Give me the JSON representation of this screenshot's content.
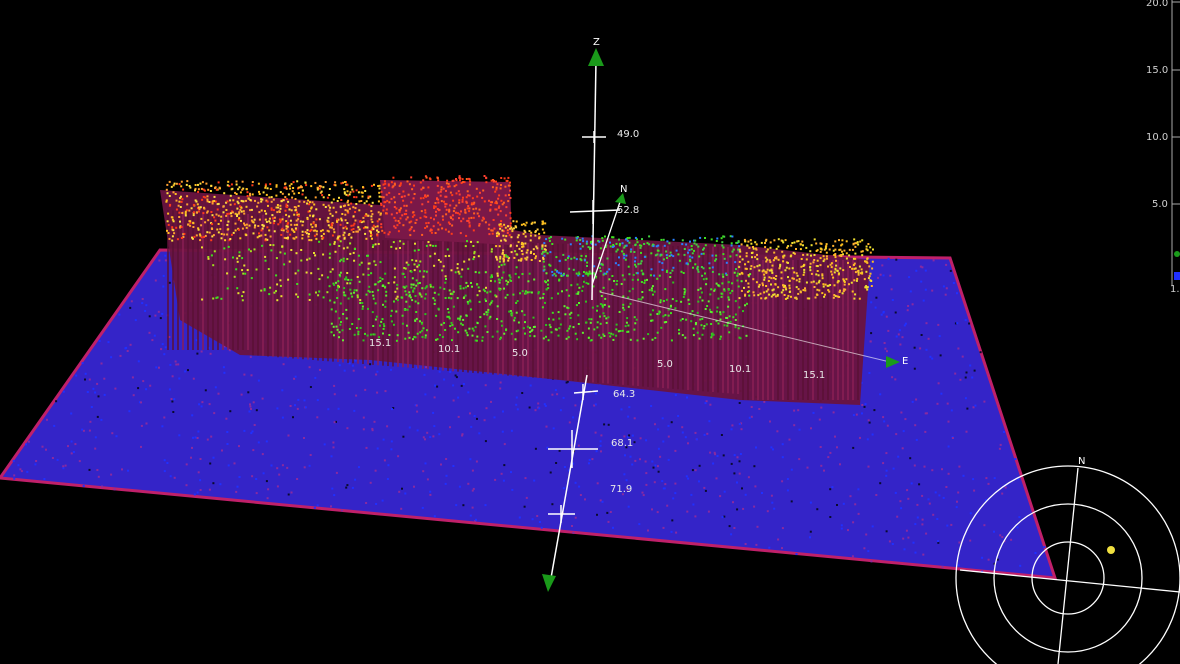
{
  "view": {
    "background": "#000000",
    "seabed_color": "#3a2ad8",
    "seabed_edge_color": "#c0206a",
    "hull_color": "#7a1848"
  },
  "axes": {
    "z_label": "Z",
    "n_label": "N",
    "e_label": "E",
    "z_ticks": [
      "49.0",
      "52.8",
      "64.3",
      "68.1",
      "71.9"
    ],
    "hull_ticks": [
      "15.1",
      "10.1",
      "5.0",
      "5.0",
      "10.1",
      "15.1"
    ]
  },
  "side_scale": {
    "ticks": [
      "20.0",
      "15.0",
      "10.0",
      "5.0"
    ],
    "partial_label": "1."
  },
  "compass": {
    "north_label": "N",
    "marker_color": "#f0e040"
  },
  "colors": {
    "high": "#ff3a1a",
    "upper": "#ffc020",
    "mid": "#40e020",
    "low": "#2030ff",
    "arrow_green": "#1a9a1a"
  }
}
